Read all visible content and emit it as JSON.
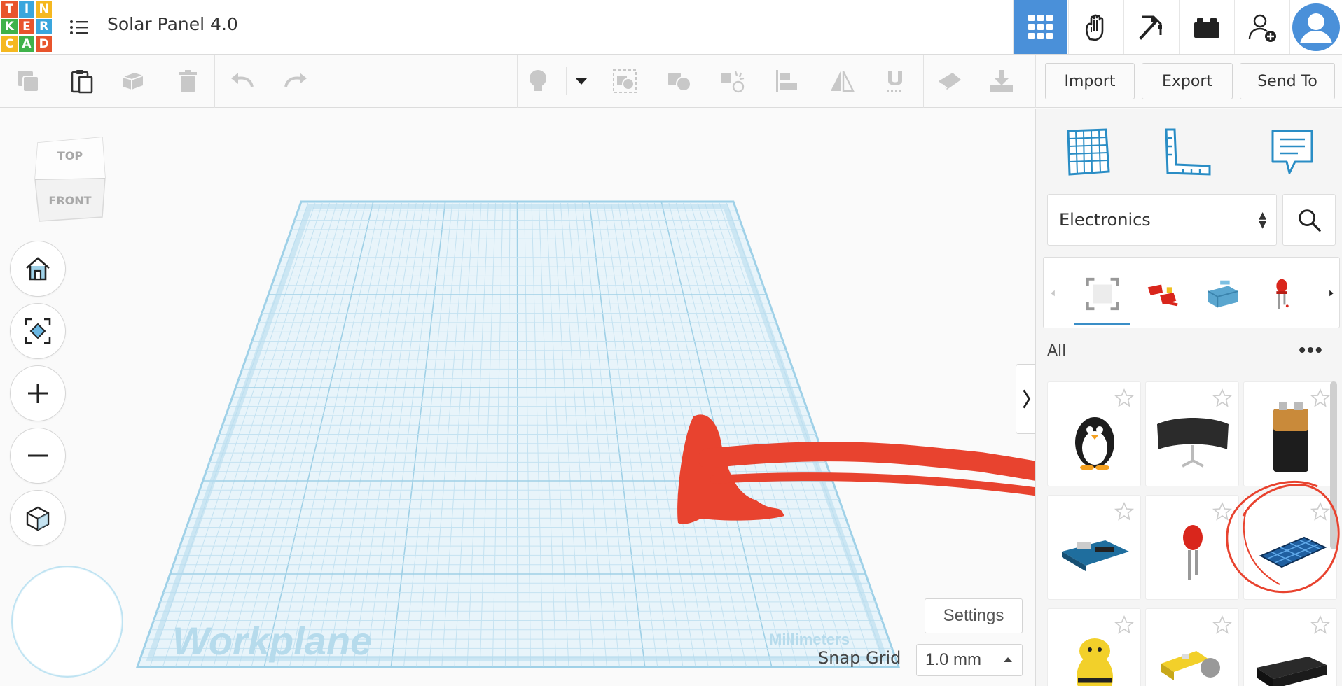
{
  "header": {
    "logo_letters": [
      "T",
      "I",
      "N",
      "K",
      "E",
      "R",
      "C",
      "A",
      "D"
    ],
    "logo_colors": [
      "#e8542c",
      "#3aa6dd",
      "#f5b820",
      "#3fb24a",
      "#e8542c",
      "#3aa6dd",
      "#f5b820",
      "#3fb24a",
      "#e8542c"
    ],
    "title": "Solar Panel 4.0",
    "buttons": [
      {
        "name": "3d-design-view-icon",
        "active": true
      },
      {
        "name": "circuits-view-icon",
        "active": false
      },
      {
        "name": "minecraft-view-icon",
        "active": false
      },
      {
        "name": "lego-bricks-view-icon",
        "active": false
      },
      {
        "name": "add-user-icon",
        "active": false
      },
      {
        "name": "user-avatar-icon",
        "active": false
      }
    ]
  },
  "toolbar": {
    "import_label": "Import",
    "export_label": "Export",
    "sendto_label": "Send To"
  },
  "viewcube": {
    "top_label": "TOP",
    "front_label": "FRONT"
  },
  "workplane": {
    "label": "Workplane",
    "units_label": "Millimeters"
  },
  "bottom_controls": {
    "settings_label": "Settings",
    "snap_label": "Snap Grid",
    "snap_value": "1.0 mm"
  },
  "right_panel": {
    "category": "Electronics",
    "filter_label": "All",
    "more_label": "•••",
    "strip_items": [
      "fit-view-icon",
      "alligator-clip-icon",
      "servo-motor-icon",
      "led-icon"
    ],
    "shapes": [
      {
        "name": "penguin-shape"
      },
      {
        "name": "curved-monitor-shape"
      },
      {
        "name": "9v-battery-shape"
      },
      {
        "name": "arduino-board-shape"
      },
      {
        "name": "red-led-shape"
      },
      {
        "name": "solar-panel-shape"
      },
      {
        "name": "bee-shape"
      },
      {
        "name": "gear-motor-shape"
      },
      {
        "name": "battery-box-shape"
      }
    ]
  },
  "colors": {
    "accent": "#3a8ec7",
    "active_tab": "#4a90d9",
    "workplane_grid": "#a8d4ea",
    "annotation_red": "#e8432f"
  }
}
